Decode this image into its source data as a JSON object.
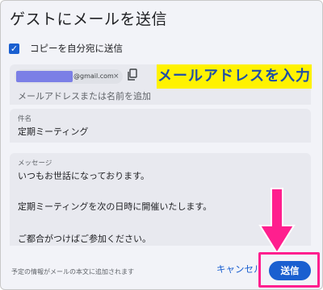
{
  "dialog": {
    "title": "ゲストにメールを送信",
    "copy_to_self_label": "コピーを自分宛に送信",
    "copy_to_self_checked": true
  },
  "recipients": {
    "chip_domain": "@gmail.com",
    "chip_close": "×",
    "placeholder": "メールアドレスまたは名前を追加",
    "copy_icon": "copy-icon"
  },
  "annotation": {
    "text": "メールアドレスを入力"
  },
  "subject": {
    "label": "件名",
    "value": "定期ミーティング"
  },
  "message": {
    "label": "メッセージ",
    "lines": [
      "いつもお世話になっております。",
      "定期ミーティングを次の日時に開催いたします。",
      "ご都合がつけばご参加ください。"
    ]
  },
  "footer": {
    "note": "予定の情報がメールの本文に追加されます",
    "cancel_label": "キャンセル",
    "send_label": "送信"
  },
  "colors": {
    "accent": "#1a5fd0",
    "annotation_bg": "#fff200",
    "highlight": "#ff1f8e"
  }
}
